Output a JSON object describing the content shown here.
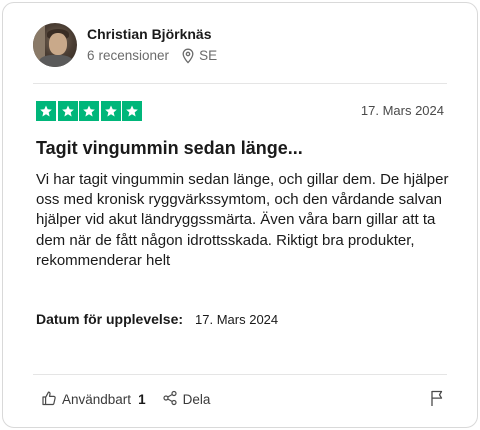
{
  "reviewer": {
    "name": "Christian Björknäs",
    "review_count": "6",
    "review_count_label": "recensioner",
    "country": "SE"
  },
  "review": {
    "rating": 5,
    "max_rating": 5,
    "star_color": "#00b67a",
    "date": "17. Mars 2024",
    "title": "Tagit vingummin sedan länge...",
    "body": "Vi har tagit vingummin sedan länge, och gillar dem. De hjälper oss med kronisk ryggvärkssymtom, och den vårdande salvan hjälper vid akut ländryggssmärta. Även våra barn gillar att ta dem när de fått någon idrottsskada. Riktigt bra produkter, rekommenderar helt",
    "experience_label": "Datum för upplevelse:",
    "experience_date": "17. Mars 2024"
  },
  "actions": {
    "useful_label": "Användbart",
    "useful_count": "1",
    "share_label": "Dela"
  },
  "icons": {
    "location": "location-pin-icon",
    "star": "star-icon",
    "useful": "thumbs-up-icon",
    "share": "share-icon",
    "report": "flag-icon"
  }
}
